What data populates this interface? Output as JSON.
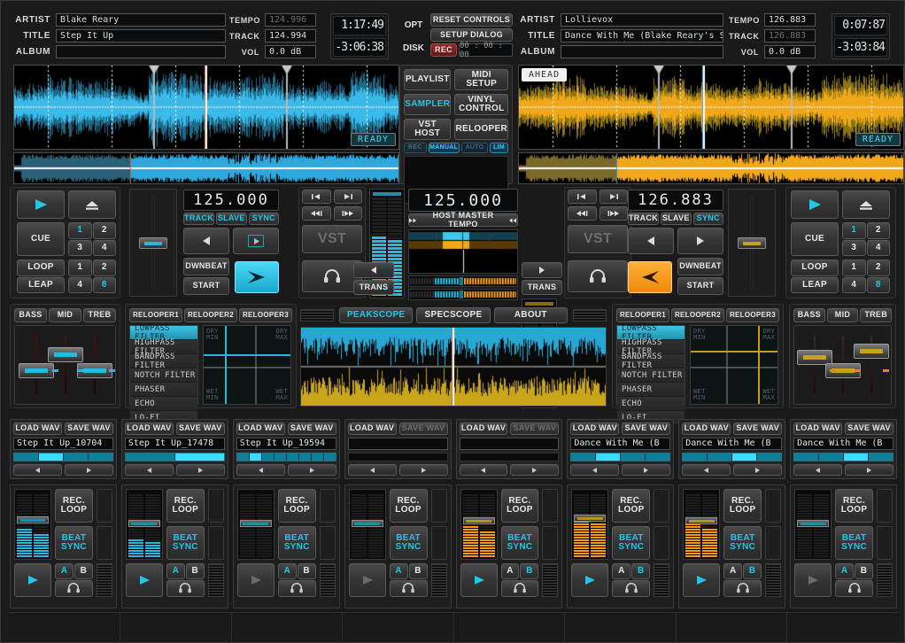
{
  "decks": {
    "left": {
      "fields": [
        {
          "label": "ARTIST",
          "value": "Blake Reary"
        },
        {
          "label": "TITLE",
          "value": "Step It Up"
        },
        {
          "label": "ALBUM",
          "value": ""
        }
      ],
      "tempo": [
        {
          "label": "TEMPO",
          "value": "124.996",
          "dim": true
        },
        {
          "label": "TRACK",
          "value": "124.994",
          "dim": false
        },
        {
          "label": "VOL",
          "value": "0.0 dB",
          "dim": false
        }
      ],
      "time_elapsed": "1:17:49",
      "time_remaining": "-3:06:38",
      "status_badge": "READY",
      "bpm_display": "125.000",
      "sync_row": [
        "TRACK",
        "SLAVE",
        "SYNC"
      ],
      "sync_active": "SYNC",
      "transport": {
        "play": "play-icon",
        "eject": "eject-icon",
        "cue": "CUE"
      },
      "hotcues": [
        "1",
        "2",
        "3",
        "4"
      ],
      "hotcue_active": "1",
      "loop_labels": [
        "LOOP",
        "LEAP"
      ],
      "loop_sizes": [
        "1",
        "2",
        "4",
        "8"
      ],
      "loop_active": "8",
      "beat_buttons": [
        "DWNBEAT",
        "START"
      ],
      "eq": [
        "BASS",
        "MID",
        "TREB"
      ],
      "relooper_tabs": [
        "RELOOPER1",
        "RELOOPER2",
        "RELOOPER3"
      ],
      "filters": [
        "LOWPASS FILTER",
        "HIGHPASS FILTER",
        "BANDPASS FILTER",
        "NOTCH FILTER",
        "PHASER",
        "ECHO",
        "LO-FI"
      ],
      "filter_selected": "LOWPASS FILTER",
      "xy_labels": {
        "tl": "DRY\nMIN",
        "tr": "DRY\nMAX",
        "bl": "WET\nMIN",
        "br": "WET\nMAX"
      },
      "vst_label": "VST",
      "trans_label": "TRANS"
    },
    "right": {
      "fields": [
        {
          "label": "ARTIST",
          "value": "Lollievox"
        },
        {
          "label": "TITLE",
          "value": "Dance With Me (Blake Reary's S"
        },
        {
          "label": "ALBUM",
          "value": ""
        }
      ],
      "tempo": [
        {
          "label": "TEMPO",
          "value": "126.883",
          "dim": false
        },
        {
          "label": "TRACK",
          "value": "126.883",
          "dim": true
        },
        {
          "label": "VOL",
          "value": "0.0 dB",
          "dim": false
        }
      ],
      "time_elapsed": "0:07:87",
      "time_remaining": "-3:03:84",
      "status_badge": "READY",
      "ahead_badge": "AHEAD",
      "bpm_display": "126.883",
      "sync_row": [
        "TRACK",
        "SLAVE",
        "SYNC"
      ],
      "sync_active": "SYNC",
      "transport": {
        "play": "play-icon",
        "eject": "eject-icon",
        "cue": "CUE"
      },
      "hotcues": [
        "1",
        "2",
        "3",
        "4"
      ],
      "hotcue_active": "1",
      "loop_labels": [
        "LOOP",
        "LEAP"
      ],
      "loop_sizes": [
        "1",
        "2",
        "4",
        "8"
      ],
      "loop_active": "8",
      "beat_buttons": [
        "DWNBEAT",
        "START"
      ],
      "eq": [
        "BASS",
        "MID",
        "TREB"
      ],
      "relooper_tabs": [
        "RELOOPER1",
        "RELOOPER2",
        "RELOOPER3"
      ],
      "filters": [
        "LOWPASS FILTER",
        "HIGHPASS FILTER",
        "BANDPASS FILTER",
        "NOTCH FILTER",
        "PHASER",
        "ECHO",
        "LO-FI"
      ],
      "filter_selected": "LOWPASS FILTER",
      "xy_labels": {
        "tl": "DRY\nMIN",
        "tr": "DRY\nMAX",
        "bl": "WET\nMIN",
        "br": "WET\nMAX"
      },
      "vst_label": "VST",
      "trans_label": "TRANS"
    }
  },
  "center": {
    "opt_label": "OPT",
    "disk_label": "DISK",
    "reset_controls": "RESET CONTROLS",
    "setup_dialog": "SETUP DIALOG",
    "rec_label": "REC",
    "rec_time": "00 : 00 : 00",
    "nav_buttons": [
      "PLAYLIST",
      "MIDI SETUP",
      "SAMPLER",
      "VINYL CONTROL",
      "VST HOST",
      "RELOOPER"
    ],
    "nav_active": "SAMPLER",
    "mini_buttons": [
      "REC",
      "MANUAL",
      "AUTO",
      "LIM"
    ],
    "mini_active": [
      "MANUAL",
      "LIM"
    ],
    "master_tempo_value": "125.000",
    "master_tempo_label": "HOST MASTER TEMPO",
    "scope_tabs": [
      "PEAKSCOPE",
      "SPECSCOPE",
      "ABOUT"
    ],
    "scope_active": "PEAKSCOPE"
  },
  "sampler_slots": [
    {
      "load": "LOAD WAV",
      "save": "SAVE WAV",
      "name": "Step It Up_10704",
      "loaded": true,
      "color": "cyan",
      "segments": 4,
      "active": 1
    },
    {
      "load": "LOAD WAV",
      "save": "SAVE WAV",
      "name": "Step It Up_17478",
      "loaded": true,
      "color": "cyan",
      "segments": 2,
      "active": 1
    },
    {
      "load": "LOAD WAV",
      "save": "SAVE WAV",
      "name": "Step It Up_19594",
      "loaded": true,
      "color": "cyan",
      "segments": 8,
      "active": 1
    },
    {
      "load": "LOAD WAV",
      "save": "SAVE WAV",
      "name": "",
      "loaded": false,
      "color": "cyan",
      "segments": 0,
      "active": -1
    },
    {
      "load": "LOAD WAV",
      "save": "SAVE WAV",
      "name": "",
      "loaded": false,
      "color": "cyan",
      "segments": 0,
      "active": -1
    },
    {
      "load": "LOAD WAV",
      "save": "SAVE WAV",
      "name": "Dance With Me (B",
      "loaded": true,
      "color": "cyan",
      "segments": 4,
      "active": 1
    },
    {
      "load": "LOAD WAV",
      "save": "SAVE WAV",
      "name": "Dance With Me (B",
      "loaded": true,
      "color": "cyan",
      "segments": 4,
      "active": 2
    },
    {
      "load": "LOAD WAV",
      "save": "SAVE WAV",
      "name": "Dance With Me (B",
      "loaded": true,
      "color": "cyan",
      "segments": 4,
      "active": 2
    }
  ],
  "sampler_decks": [
    {
      "rec_loop": "REC. LOOP",
      "beat_sync": "BEAT SYNC",
      "play": "play-icon",
      "a": "A",
      "b": "B",
      "cue": "headphone-icon",
      "meter": "cyan",
      "level": 0.45,
      "handle": 0.42,
      "ab_active": "A"
    },
    {
      "rec_loop": "REC. LOOP",
      "beat_sync": "BEAT SYNC",
      "play": "play-icon",
      "a": "A",
      "b": "B",
      "cue": "headphone-icon",
      "meter": "cyan",
      "level": 0.3,
      "handle": 0.5,
      "ab_active": "A"
    },
    {
      "rec_loop": "REC. LOOP",
      "beat_sync": "BEAT SYNC",
      "play": "play-icon",
      "a": "A",
      "b": "B",
      "cue": "headphone-icon",
      "meter": "none",
      "level": 0.0,
      "handle": 0.5,
      "ab_active": "A"
    },
    {
      "rec_loop": "REC. LOOP",
      "beat_sync": "BEAT SYNC",
      "play": "play-icon",
      "a": "A",
      "b": "B",
      "cue": "headphone-icon",
      "meter": "none",
      "level": 0.0,
      "handle": 0.5,
      "ab_active": "A"
    },
    {
      "rec_loop": "REC. LOOP",
      "beat_sync": "BEAT SYNC",
      "play": "play-icon",
      "a": "A",
      "b": "B",
      "cue": "headphone-icon",
      "meter": "orange",
      "level": 0.5,
      "handle": 0.45,
      "ab_active": "B"
    },
    {
      "rec_loop": "REC. LOOP",
      "beat_sync": "BEAT SYNC",
      "play": "play-icon",
      "a": "A",
      "b": "B",
      "cue": "headphone-icon",
      "meter": "orange",
      "level": 0.62,
      "handle": 0.4,
      "ab_active": "B"
    },
    {
      "rec_loop": "REC. LOOP",
      "beat_sync": "BEAT SYNC",
      "play": "play-icon",
      "a": "A",
      "b": "B",
      "cue": "headphone-icon",
      "meter": "orange",
      "level": 0.55,
      "handle": 0.44,
      "ab_active": "B"
    },
    {
      "rec_loop": "REC. LOOP",
      "beat_sync": "BEAT SYNC",
      "play": "play-icon",
      "a": "A",
      "b": "B",
      "cue": "headphone-icon",
      "meter": "none",
      "level": 0.0,
      "handle": 0.5,
      "ab_active": "A"
    }
  ],
  "colors": {
    "cyan": "#27b9e0",
    "orange": "#f59b13",
    "wave_left": "#3bb9e8",
    "wave_right": "#f0a81a",
    "panel": "#232323",
    "bg": "#1a1a1a"
  }
}
